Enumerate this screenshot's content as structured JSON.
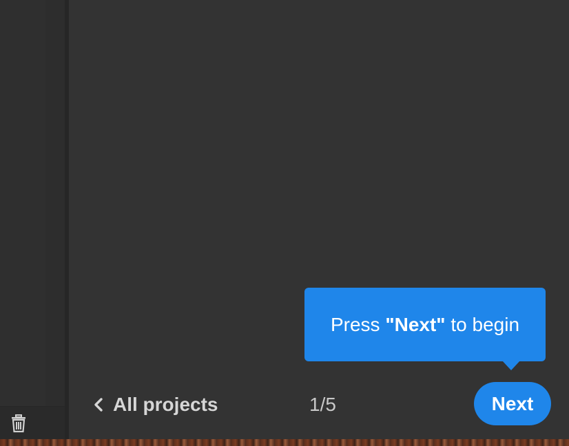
{
  "tooltip": {
    "prefix": "Press ",
    "keyword": "\"Next\"",
    "suffix": " to begin"
  },
  "footer": {
    "back_label": "All projects",
    "page_counter": "1/5",
    "next_label": "Next"
  },
  "colors": {
    "accent": "#1f86ea",
    "background": "#333333",
    "sidebar": "#2d2d2d"
  },
  "icons": {
    "trash": "trash-icon",
    "back": "chevron-left-icon"
  }
}
